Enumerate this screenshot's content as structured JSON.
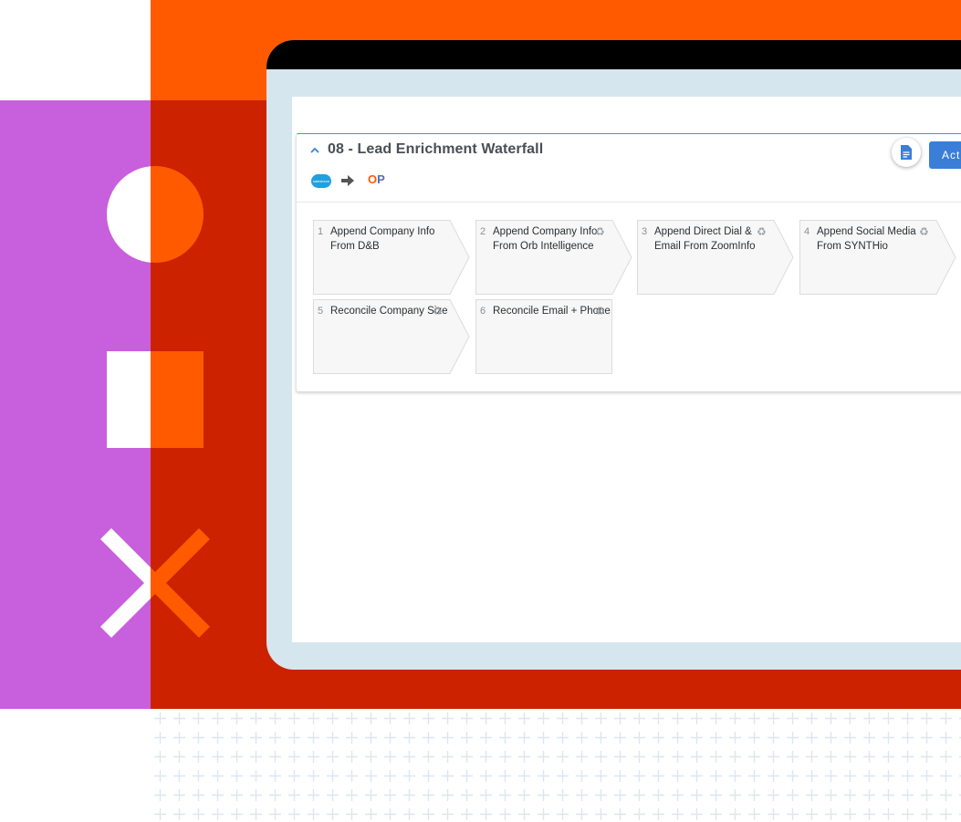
{
  "workflow": {
    "title": "08 - Lead Enrichment Waterfall",
    "source_logo_text": "salesforce",
    "destination_logo": {
      "o": "O",
      "p": "P"
    },
    "actions_label": "Actions"
  },
  "steps": [
    {
      "num": "1",
      "label": "Append Company Info From D&B",
      "icon": "none"
    },
    {
      "num": "2",
      "label": "Append Company Info From Orb Intelligence",
      "icon": "recycle-icon"
    },
    {
      "num": "3",
      "label": "Append Direct Dial & Email From ZoomInfo",
      "icon": "recycle-icon"
    },
    {
      "num": "4",
      "label": "Append Social Media From SYNTHio",
      "icon": "recycle-icon"
    },
    {
      "num": "5",
      "label": "Reconcile Company Size",
      "icon": "recycle-icon"
    },
    {
      "num": "6",
      "label": "Reconcile Email + Phone",
      "icon": "recycle-icon"
    }
  ],
  "icons": {
    "recycle": "♻",
    "collapse": "^",
    "arrow": "➡"
  },
  "colors": {
    "orange": "#ff5a00",
    "red": "#cc2200",
    "purple": "#c85fdc",
    "accent": "#3b7ed8"
  }
}
